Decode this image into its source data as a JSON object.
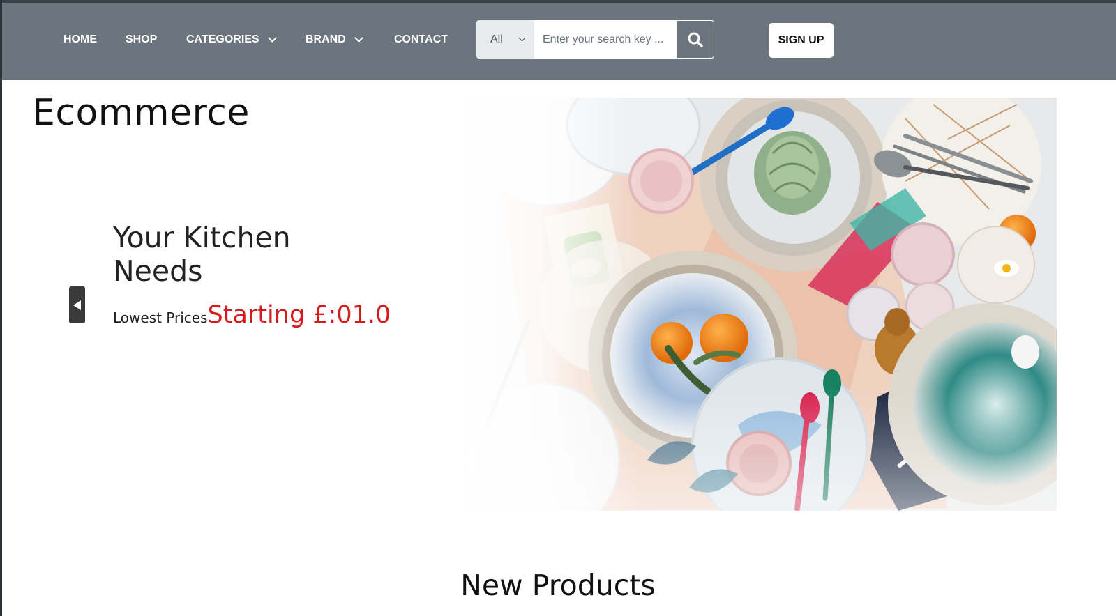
{
  "nav": {
    "items": [
      {
        "label": "HOME"
      },
      {
        "label": "SHOP"
      },
      {
        "label": "CATEGORIES"
      },
      {
        "label": "BRAND"
      },
      {
        "label": "CONTACT"
      }
    ],
    "search": {
      "category_selected": "All",
      "placeholder": "Enter your search key ..."
    },
    "signup_label": "SIGN UP"
  },
  "hero": {
    "brand": "Ecommerce",
    "heading": "Your Kitchen Needs",
    "subtext": "Lowest Prices",
    "price_text": "Starting £:01.0"
  },
  "sections": {
    "new_products_title": "New Products"
  },
  "colors": {
    "navbar_bg": "#6c757d",
    "price_red": "#d41c1c",
    "search_select_bg": "#e9ecef"
  }
}
